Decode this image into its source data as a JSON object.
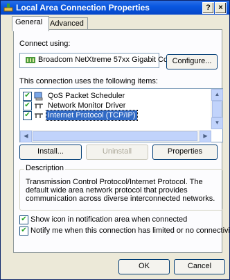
{
  "window": {
    "title": "Local Area Connection Properties",
    "help_label": "?",
    "close_label": "×"
  },
  "tabs": [
    {
      "label": "General",
      "active": true
    },
    {
      "label": "Advanced",
      "active": false
    }
  ],
  "general": {
    "connect_using_label": "Connect using:",
    "adapter_name": "Broadcom NetXtreme 57xx Gigabit Cc",
    "configure_label": "Configure...",
    "items_label": "This connection uses the following items:",
    "items": [
      {
        "label": "QoS Packet Scheduler",
        "checked": true,
        "icon": "scheduler-icon"
      },
      {
        "label": "Network Monitor Driver",
        "checked": true,
        "icon": "protocol-icon"
      },
      {
        "label": "Internet Protocol (TCP/IP)",
        "checked": true,
        "icon": "protocol-icon",
        "selected": true
      }
    ],
    "install_label": "Install...",
    "uninstall_label": "Uninstall",
    "properties_label": "Properties",
    "description_legend": "Description",
    "description_text": "Transmission Control Protocol/Internet Protocol. The default wide area network protocol that provides communication across diverse interconnected networks.",
    "show_icon_label": "Show icon in notification area when connected",
    "show_icon_checked": true,
    "notify_label": "Notify me when this connection has limited or no connectivity",
    "notify_checked": true
  },
  "footer": {
    "ok_label": "OK",
    "cancel_label": "Cancel"
  },
  "colors": {
    "titlebar": "#0a58e0",
    "selection": "#316ac5",
    "dialog_bg": "#ece9d8"
  }
}
